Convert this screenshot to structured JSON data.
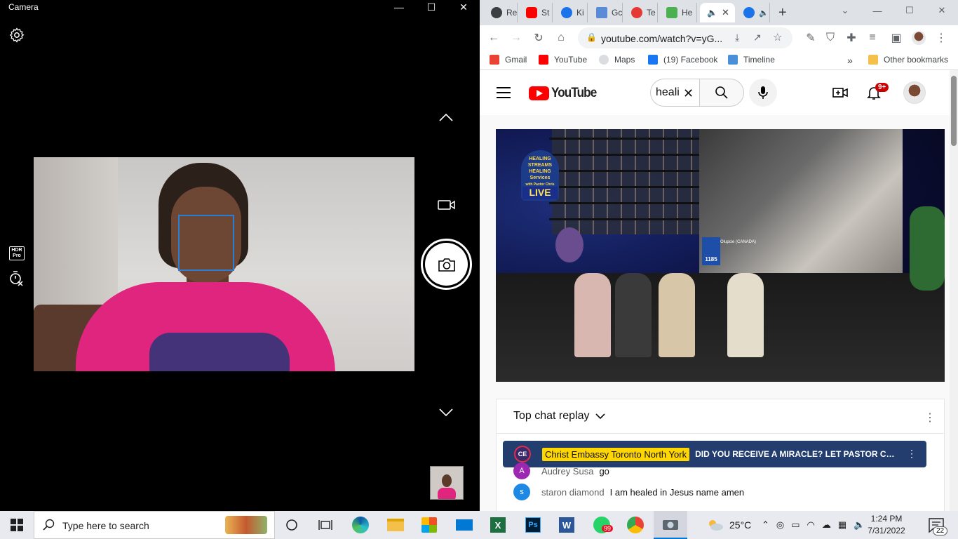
{
  "camera": {
    "title": "Camera",
    "window_controls": {
      "minimize": "—",
      "maximize": "☐",
      "close": "✕"
    },
    "hdr_label": "HDR Pro"
  },
  "browser": {
    "tabs": [
      {
        "label": "Re",
        "favicon_color": "#3c4043"
      },
      {
        "label": "St",
        "favicon_color": "#ff0000"
      },
      {
        "label": "Ki",
        "favicon_color": "#1a73e8"
      },
      {
        "label": "Gc",
        "favicon_color": "#5b8ad6"
      },
      {
        "label": "Te",
        "favicon_color": "#e53935"
      },
      {
        "label": "He",
        "favicon_color": "#4caf50"
      },
      {
        "label": "",
        "favicon_color": "#3c4043",
        "active": true
      },
      {
        "label": "",
        "favicon_color": "#1a73e8"
      }
    ],
    "url": "youtube.com/watch?v=yG...",
    "bookmarks": [
      {
        "label": "Gmail",
        "color": "#ea4335"
      },
      {
        "label": "YouTube",
        "color": "#ff0000"
      },
      {
        "label": "Maps",
        "color": "#dadce0"
      },
      {
        "label": "(19) Facebook",
        "color": "#1877f2"
      },
      {
        "label": "Timeline",
        "color": "#4a90d9"
      }
    ],
    "bookmarks_overflow": "»",
    "other_bookmarks": "Other bookmarks"
  },
  "youtube": {
    "logo_text": "YouTube",
    "search_value": "heali",
    "notification_count": "9+",
    "video": {
      "logo_lines": [
        "HEALING",
        "STREAMS",
        "HEALING"
      ],
      "logo_script": "Services",
      "logo_subtitle": "with Pastor Chris",
      "live_label": "LIVE",
      "sign_number": "1185",
      "sign_caption": "Olupcie (CANADA)"
    },
    "chat": {
      "title": "Top chat replay",
      "pinned": {
        "avatar_initials": "CE",
        "author": "Christ Embassy Toronto North York",
        "message": "DID YOU RECEIVE A MIRACLE? LET PASTOR CH..."
      },
      "messages": [
        {
          "initial": "A",
          "color": "#9c27b0",
          "author": "Audrey Susa",
          "text": "go"
        },
        {
          "initial": "s",
          "color": "#1e88e5",
          "author": "staron diamond",
          "text": "I am healed in Jesus name amen"
        }
      ]
    }
  },
  "taskbar": {
    "search_placeholder": "Type here to search",
    "whatsapp_badge": "99",
    "weather": "25°C",
    "time": "1:24 PM",
    "date": "7/31/2022",
    "notifications": "22"
  }
}
